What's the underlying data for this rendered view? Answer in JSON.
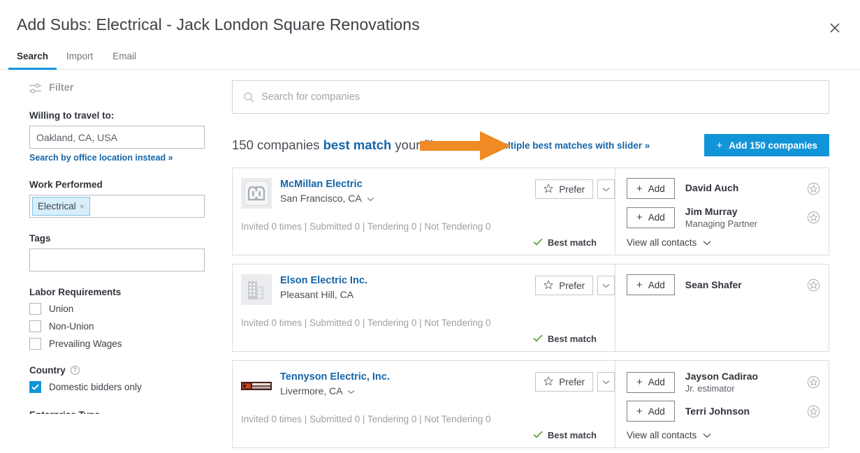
{
  "header": {
    "title": "Add Subs: Electrical - Jack London Square Renovations",
    "close_label": "×"
  },
  "tabs": [
    {
      "label": "Search",
      "active": true
    },
    {
      "label": "Import",
      "active": false
    },
    {
      "label": "Email",
      "active": false
    }
  ],
  "sidebar": {
    "filter_label": "Filter",
    "travel": {
      "label": "Willing to travel to:",
      "value": "Oakland, CA, USA",
      "alt_link": "Search by office location instead »"
    },
    "work_performed": {
      "label": "Work Performed",
      "chips": [
        {
          "label": "Electrical",
          "remove": "×"
        }
      ]
    },
    "tags": {
      "label": "Tags",
      "value": ""
    },
    "labor": {
      "label": "Labor Requirements",
      "options": [
        {
          "label": "Union",
          "checked": false
        },
        {
          "label": "Non-Union",
          "checked": false
        },
        {
          "label": "Prevailing Wages",
          "checked": false
        }
      ]
    },
    "country": {
      "label": "Country",
      "help": "?",
      "options": [
        {
          "label": "Domestic bidders only",
          "checked": true
        }
      ]
    },
    "cut_off_section": "Enterprise Type"
  },
  "search": {
    "placeholder": "Search for companies"
  },
  "results": {
    "count_prefix": "150 companies ",
    "count_emphasis": "best match",
    "count_suffix": " your filters",
    "slider_link": "Add multiple best matches with slider »",
    "add_all_button": "Add 150 companies",
    "add_all_plus": "+"
  },
  "companies": [
    {
      "name": "McMillan Electric",
      "location": "San Francisco, CA",
      "has_location_caret": true,
      "logo": "mcmillan-outlet-logo",
      "prefer_label": "Prefer",
      "stats": "Invited 0 times | Submitted 0 | Tendering 0 | Not Tendering 0",
      "best_match_label": "Best match",
      "view_all_label": "View all contacts",
      "show_view_all": true,
      "contacts": [
        {
          "add_label": "Add",
          "name": "David Auch",
          "title": ""
        },
        {
          "add_label": "Add",
          "name": "Jim Murray",
          "title": "Managing Partner"
        }
      ]
    },
    {
      "name": "Elson Electric Inc.",
      "location": "Pleasant Hill, CA",
      "has_location_caret": false,
      "logo": "building-placeholder-logo",
      "prefer_label": "Prefer",
      "stats": "Invited 0 times | Submitted 0 | Tendering 0 | Not Tendering 0",
      "best_match_label": "Best match",
      "view_all_label": "",
      "show_view_all": false,
      "contacts": [
        {
          "add_label": "Add",
          "name": "Sean Shafer",
          "title": ""
        }
      ]
    },
    {
      "name": "Tennyson Electric, Inc.",
      "location": "Livermore, CA",
      "has_location_caret": true,
      "logo": "tennyson-banner-logo",
      "prefer_label": "Prefer",
      "stats": "Invited 0 times | Submitted 0 | Tendering 0 | Not Tendering 0",
      "best_match_label": "Best match",
      "view_all_label": "View all contacts",
      "show_view_all": true,
      "contacts": [
        {
          "add_label": "Add",
          "name": "Jayson Cadirao",
          "title": "Jr. estimator"
        },
        {
          "add_label": "Add",
          "name": "Terri Johnson",
          "title": ""
        }
      ]
    }
  ],
  "annotation": {
    "type": "arrow",
    "direction": "right",
    "color": "#f08a24"
  },
  "colors": {
    "accent_blue": "#1295d8",
    "link_blue": "#1565a8",
    "best_match_green": "#5a9e3f",
    "annotation_orange": "#f08a24"
  }
}
